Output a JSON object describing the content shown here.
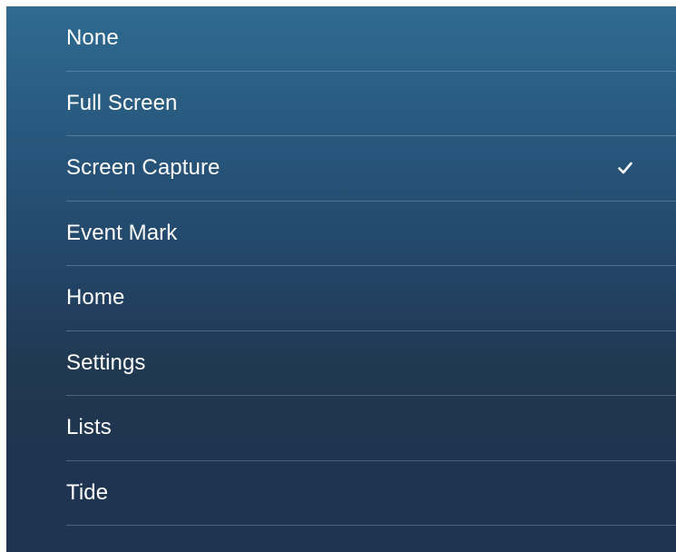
{
  "menu": {
    "items": [
      {
        "label": "None",
        "selected": false
      },
      {
        "label": "Full Screen",
        "selected": false
      },
      {
        "label": "Screen Capture",
        "selected": true
      },
      {
        "label": "Event Mark",
        "selected": false
      },
      {
        "label": "Home",
        "selected": false
      },
      {
        "label": "Settings",
        "selected": false
      },
      {
        "label": "Lists",
        "selected": false
      },
      {
        "label": "Tide",
        "selected": false
      }
    ],
    "check_icon": "checkmark-icon"
  },
  "colors": {
    "panel_top": "#2f6b93",
    "panel_bottom": "#1e3450",
    "text": "#ffffff",
    "divider": "#a0bed7"
  }
}
